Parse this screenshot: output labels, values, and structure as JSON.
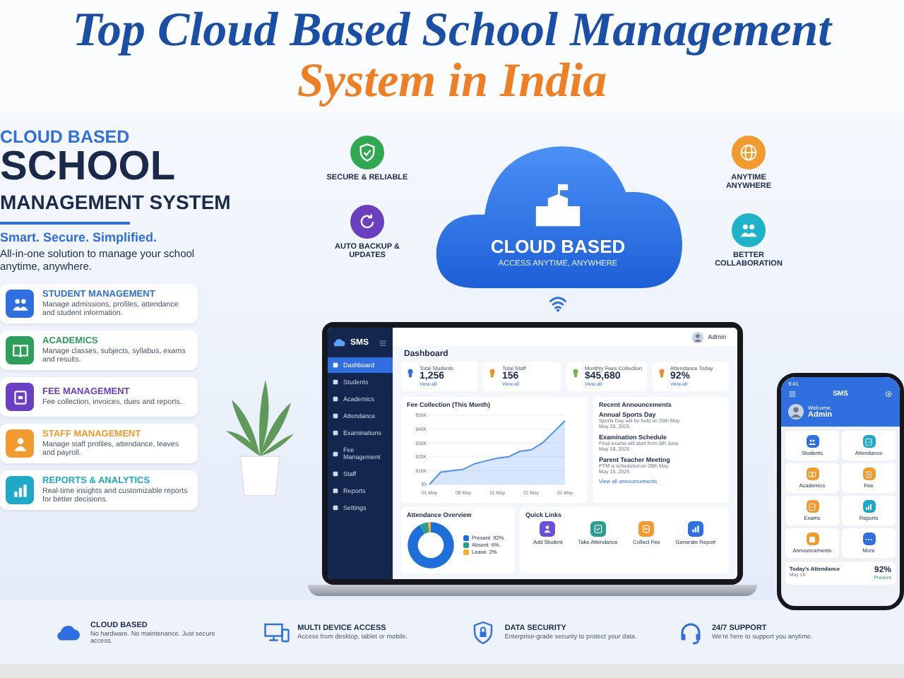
{
  "title": {
    "line_1": "Top Cloud Based School Management",
    "line_2": "System in India"
  },
  "hero": {
    "eyebrow": "CLOUD BASED",
    "headline": "SCHOOL",
    "subhead": "MANAGEMENT SYSTEM",
    "tagline": "Smart. Secure. Simplified.",
    "description": "All-in-one solution to manage your school anytime, anywhere."
  },
  "modules": [
    {
      "title": "STUDENT MANAGEMENT",
      "description": "Manage admissions, profiles, attendance and student information.",
      "color": "#2f6fe0"
    },
    {
      "title": "ACADEMICS",
      "description": "Manage classes, subjects, syllabus, exams and results.",
      "color": "#2e9e5b"
    },
    {
      "title": "FEE MANAGEMENT",
      "description": "Fee collection, invoices, dues and reports.",
      "color": "#6b3fc4"
    },
    {
      "title": "STAFF MANAGEMENT",
      "description": "Manage staff profiles, attendance, leaves and payroll.",
      "color": "#f29a2e"
    },
    {
      "title": "REPORTS & ANALYTICS",
      "description": "Real-time insights and customizable reports for better decisions.",
      "color": "#1fa9c9"
    }
  ],
  "cloud": {
    "title": "CLOUD BASED",
    "subtitle": "ACCESS ANYTIME, ANYWHERE"
  },
  "benefits": [
    {
      "label": "SECURE & RELIABLE",
      "color": "#2fa84f"
    },
    {
      "label": "AUTO BACKUP & UPDATES",
      "color": "#6a3fc0"
    },
    {
      "label": "ANYTIME ANYWHERE",
      "color": "#f29a2e"
    },
    {
      "label": "BETTER COLLABORATION",
      "color": "#1fb3c9"
    }
  ],
  "dashboard": {
    "brand": "SMS",
    "user": "Admin",
    "heading": "Dashboard",
    "nav": [
      {
        "label": "Dashboard",
        "selected": true
      },
      {
        "label": "Students",
        "selected": false
      },
      {
        "label": "Academics",
        "selected": false
      },
      {
        "label": "Attendance",
        "selected": false
      },
      {
        "label": "Examinations",
        "selected": false
      },
      {
        "label": "Fee Management",
        "selected": false
      },
      {
        "label": "Staff",
        "selected": false
      },
      {
        "label": "Reports",
        "selected": false
      },
      {
        "label": "Settings",
        "selected": false
      }
    ],
    "stats": [
      {
        "label": "Total Students",
        "value": "1,256",
        "link": "View all",
        "color": "#2f6fe0"
      },
      {
        "label": "Total Staff",
        "value": "156",
        "link": "View all",
        "color": "#f28c28"
      },
      {
        "label": "Monthly Fees Collection",
        "value": "$45,680",
        "link": "View all",
        "color": "#7cb342"
      },
      {
        "label": "Attendance Today",
        "value": "92%",
        "link": "View all",
        "color": "#f28c28"
      }
    ],
    "fee_chart": {
      "chart_data": {
        "type": "area",
        "title": "Fee Collection (This Month)",
        "categories": [
          "01 May",
          null,
          null,
          "08 May",
          null,
          null,
          "15 May",
          null,
          null,
          "22 May",
          null,
          null,
          "31 May"
        ],
        "series": [
          {
            "color": "#4f8ef7",
            "values": [
              0,
              9000,
              10000,
              11000,
              15000,
              17000,
              19000,
              20000,
              24000,
              25000,
              30000,
              38000,
              46000
            ]
          }
        ],
        "ylim": [
          0,
          50000
        ],
        "grid": true,
        "yticks": [
          {
            "value": 0,
            "label": "$0"
          },
          {
            "value": 10000,
            "label": "$10K"
          },
          {
            "value": 20000,
            "label": "$20K"
          },
          {
            "value": 30000,
            "label": "$30K"
          },
          {
            "value": 40000,
            "label": "$40K"
          },
          {
            "value": 50000,
            "label": "$50K"
          }
        ]
      }
    },
    "announcements": {
      "title": "Recent Announcements",
      "items": [
        {
          "title": "Annual Sports Day",
          "text": "Sports Day will be held on 25th May",
          "date": "May 20, 2025"
        },
        {
          "title": "Examination Schedule",
          "text": "Final exams will start from 5th June",
          "date": "May 18, 2025"
        },
        {
          "title": "Parent Teacher Meeting",
          "text": "PTM is scheduled on 28th May",
          "date": "May 15, 2025"
        }
      ],
      "link": "View all announcements"
    },
    "attendance": {
      "title": "Attendance Overview",
      "chart_data": {
        "type": "donut",
        "categories": [
          "Present",
          "Absent",
          "Leave"
        ],
        "values": [
          92,
          6,
          2
        ],
        "value_labels": [
          "92%",
          "6%",
          "2%"
        ],
        "colors": [
          "#1e6fd9",
          "#2a9d8f",
          "#f2b134"
        ]
      }
    },
    "quick_links": {
      "title": "Quick Links",
      "items": [
        {
          "label": "Add Student",
          "color": "#6b4fd8"
        },
        {
          "label": "Take Attendance",
          "color": "#2a9d8f"
        },
        {
          "label": "Collect Fee",
          "color": "#f29a2e"
        },
        {
          "label": "Generate Report",
          "color": "#2f6fe0"
        }
      ]
    }
  },
  "phone": {
    "time": "9:41",
    "title": "SMS",
    "greeting": "Welcome,",
    "user": "Admin",
    "tiles": [
      {
        "label": "Students",
        "color": "#2f6fe0"
      },
      {
        "label": "Attendance",
        "color": "#1fa9c9"
      },
      {
        "label": "Academics",
        "color": "#f29a2e"
      },
      {
        "label": "Fee",
        "color": "#f29a2e"
      },
      {
        "label": "Exams",
        "color": "#f29a2e"
      },
      {
        "label": "Reports",
        "color": "#1fa9c9"
      },
      {
        "label": "Announcements",
        "color": "#f29a2e"
      },
      {
        "label": "More",
        "color": "#2f6fe0"
      }
    ],
    "attendance": {
      "title": "Today's Attendance",
      "date": "May 16",
      "value": "92%",
      "status": "Present"
    }
  },
  "features": [
    {
      "title": "CLOUD BASED",
      "description": "No hardware. No maintenance. Just secure access."
    },
    {
      "title": "MULTI DEVICE ACCESS",
      "description": "Access from desktop, tablet or mobile."
    },
    {
      "title": "DATA SECURITY",
      "description": "Enterprise-grade security to protect your data."
    },
    {
      "title": "24/7 SUPPORT",
      "description": "We're here to support you anytime."
    }
  ]
}
